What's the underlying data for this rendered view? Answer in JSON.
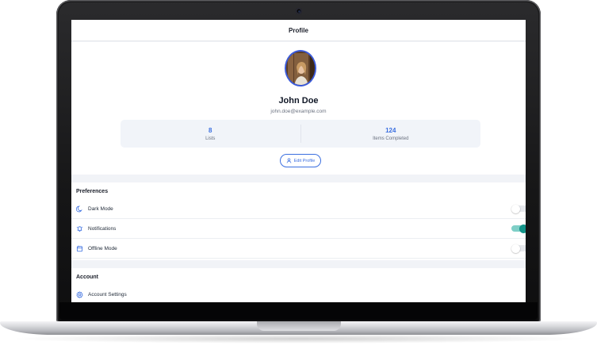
{
  "header": {
    "title": "Profile"
  },
  "profile": {
    "name": "John Doe",
    "email": "john.doe@example.com",
    "stats": [
      {
        "value": "8",
        "label": "Lists"
      },
      {
        "value": "124",
        "label": "Items Completed"
      }
    ],
    "edit_button": {
      "label": "Edit Profile",
      "icon": "user-icon"
    }
  },
  "preferences": {
    "title": "Preferences",
    "items": [
      {
        "label": "Dark Mode",
        "icon": "moon-icon",
        "enabled": false
      },
      {
        "label": "Notifications",
        "icon": "bell-icon",
        "enabled": true
      },
      {
        "label": "Offline Mode",
        "icon": "offline-icon",
        "enabled": false
      }
    ]
  },
  "account": {
    "title": "Account",
    "items": [
      {
        "label": "Account Settings",
        "icon": "gear-icon"
      }
    ]
  },
  "colors": {
    "accent": "#3b6fe0",
    "toggle_on": "#149489",
    "page_background": "#f1f3f7"
  }
}
